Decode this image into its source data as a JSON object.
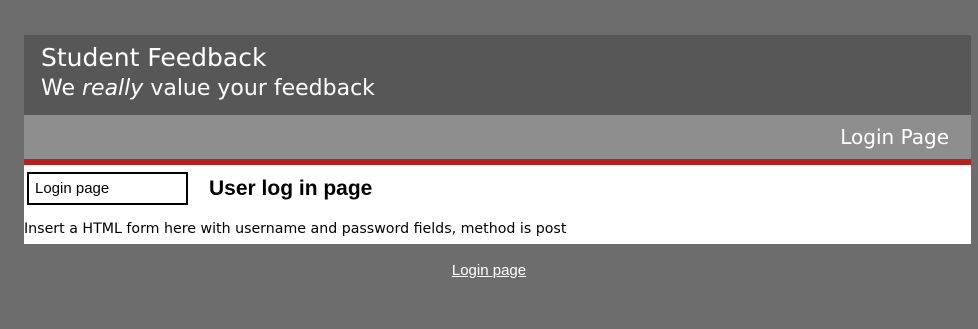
{
  "header": {
    "title": "Student Feedback",
    "tagline_prefix": "We",
    "tagline_emphasis": "really",
    "tagline_suffix": "value your feedback"
  },
  "subheader": {
    "page_label": "Login Page"
  },
  "content": {
    "nav_link": "Login page",
    "heading": "User log in page",
    "body": "Insert a HTML form here with username and password fields, method is post"
  },
  "footer": {
    "link": "Login page"
  },
  "colors": {
    "page_background": "#6d6d6d",
    "header_background": "#575757",
    "subbar_background": "#8e8e8e",
    "accent_rule": "#b5211f",
    "content_background": "#ffffff"
  }
}
